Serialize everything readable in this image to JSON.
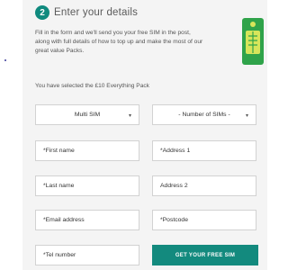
{
  "step": {
    "number": "2",
    "title": "Enter your details"
  },
  "intro": "Fill in the form and we'll send you your free SIM in the post, along with full details of how to top up and make the most of our great value Packs.",
  "selected_pack": "You have selected the £10 Everything Pack",
  "colors": {
    "accent": "#138a7e",
    "sim_body": "#2fa34a",
    "sim_chip": "#d6e55a"
  },
  "form": {
    "sim_type": {
      "value": "Multi SIM"
    },
    "sim_count": {
      "value": "- Number of SIMs -"
    },
    "first_name": {
      "placeholder": "*First name"
    },
    "address1": {
      "placeholder": "*Address 1"
    },
    "last_name": {
      "placeholder": "*Last name"
    },
    "address2": {
      "placeholder": "Address 2"
    },
    "email": {
      "placeholder": "*Email address"
    },
    "postcode": {
      "placeholder": "*Postcode"
    },
    "tel": {
      "placeholder": "*Tel number"
    },
    "submit_label": "GET YOUR FREE SIM"
  },
  "icons": {
    "select_arrow": "chevron-down-icon",
    "sim": "sim-card-icon"
  }
}
